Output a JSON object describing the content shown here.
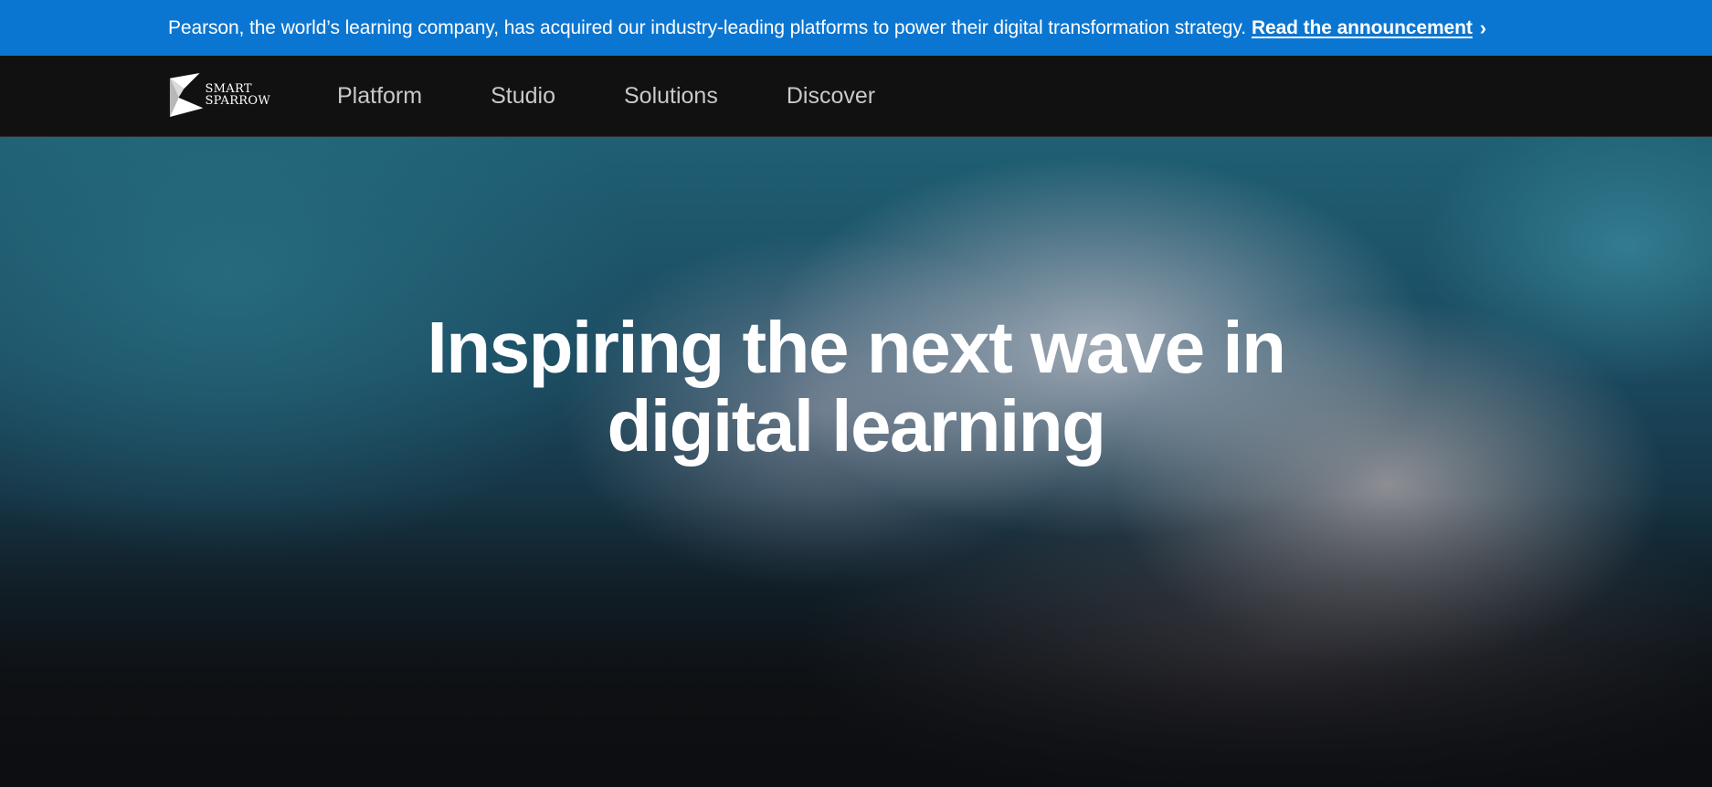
{
  "announcement": {
    "text": "Pearson, the world’s learning company, has acquired our industry-leading platforms to power their digital transformation strategy.",
    "link_label": "Read the announcement",
    "chevron": "›",
    "background_color": "#0b76d1"
  },
  "header": {
    "logo": {
      "line1": "SMART",
      "line2": "SPARROW",
      "icon": "sparrow-logo-icon"
    },
    "nav_items": [
      {
        "label": "Platform"
      },
      {
        "label": "Studio"
      },
      {
        "label": "Solutions"
      },
      {
        "label": "Discover"
      }
    ]
  },
  "hero": {
    "title_line1": "Inspiring the next wave in",
    "title_line2": "digital learning"
  }
}
